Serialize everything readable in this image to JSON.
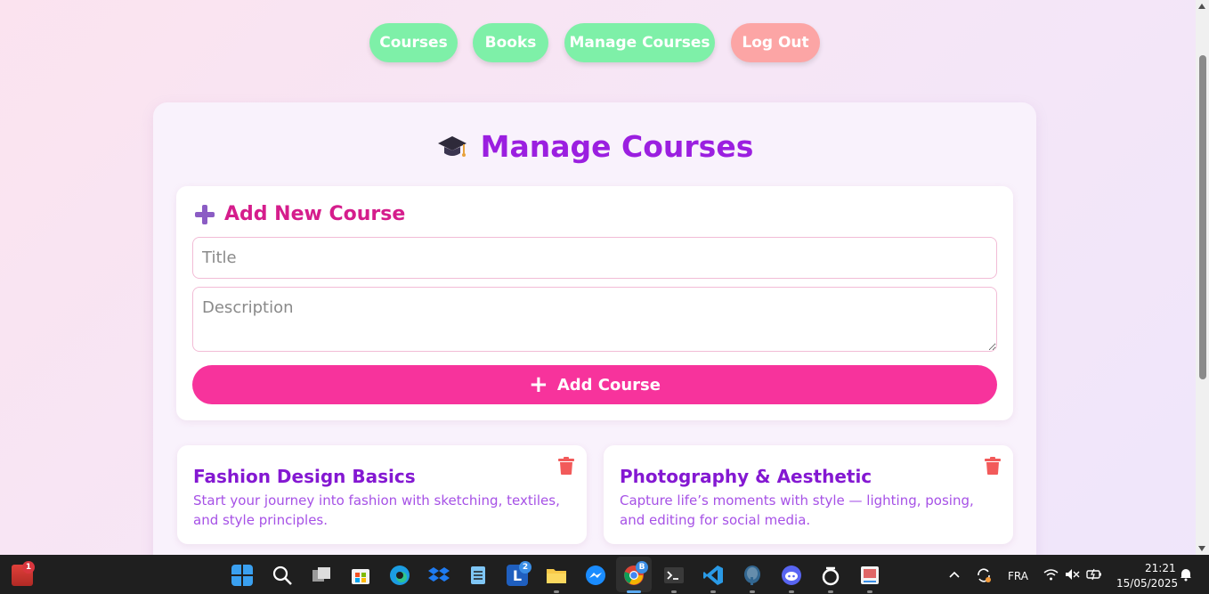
{
  "nav": {
    "courses": "Courses",
    "books": "Books",
    "manage": "Manage Courses",
    "logout": "Log Out"
  },
  "page": {
    "title": "Manage Courses",
    "icon": "graduation-cap-icon"
  },
  "add_form": {
    "heading": "Add New Course",
    "title_placeholder": "Title",
    "description_placeholder": "Description",
    "button_label": "Add Course",
    "button_icon": "+"
  },
  "courses": [
    {
      "title": "Fashion Design Basics",
      "description": "Start your journey into fashion with sketching, textiles, and style principles."
    },
    {
      "title": "Photography & Aesthetic",
      "description": "Capture life’s moments with style — lighting, posing, and editing for social media."
    }
  ],
  "colors": {
    "nav_green": "#7ef0a8",
    "nav_red": "#fca5a5",
    "title_purple": "#9b1fe0",
    "heading_pink": "#d51d8c",
    "button_pink": "#f7339c",
    "course_title": "#8418d2",
    "course_desc": "#a651e6",
    "trash_red": "#f25a5a"
  },
  "taskbar": {
    "notification_badge": "1",
    "word_badge": "2",
    "chrome_badge": "B",
    "language": "FRA",
    "time": "21:21",
    "date": "15/05/2025",
    "apps": [
      "stack-icon",
      "windows-start-icon",
      "search-icon",
      "task-view-icon",
      "store-icon",
      "edge-icon",
      "dropbox-icon",
      "notepad-icon",
      "word-icon",
      "file-explorer-icon",
      "messenger-icon",
      "chrome-icon",
      "terminal-icon",
      "vscode-icon",
      "postgres-icon",
      "discord-icon",
      "circle-app-icon",
      "snipping-icon"
    ]
  }
}
